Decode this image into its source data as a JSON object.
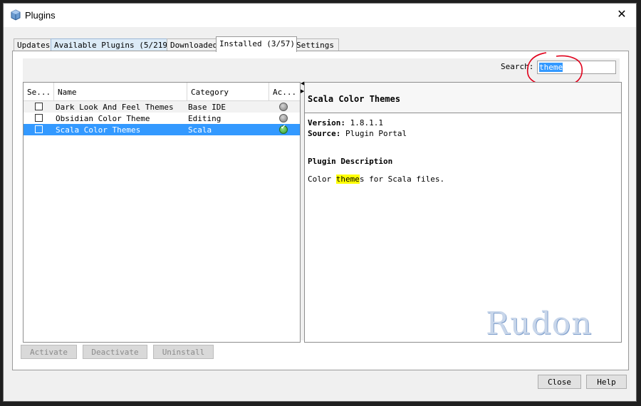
{
  "window": {
    "title": "Plugins"
  },
  "tabs": [
    {
      "label": "Updates"
    },
    {
      "label": "Available Plugins (5/219)"
    },
    {
      "label": "Downloaded"
    },
    {
      "label": "Installed (3/57)"
    },
    {
      "label": "Settings"
    }
  ],
  "search": {
    "label": "Search:",
    "value": "theme"
  },
  "table": {
    "columns": [
      "Se...",
      "Name",
      "Category",
      "Ac..."
    ],
    "rows": [
      {
        "name": "Dark Look And Feel Themes",
        "category": "Base IDE",
        "checked": false,
        "status_icon": "gray-circle-icon"
      },
      {
        "name": "Obsidian Color Theme",
        "category": "Editing",
        "checked": false,
        "status_icon": "gray-circle-icon"
      },
      {
        "name": "Scala Color Themes",
        "category": "Scala",
        "checked": false,
        "status_icon": "green-check-icon",
        "selected": true
      }
    ]
  },
  "details": {
    "title": "Scala Color Themes",
    "version_label": "Version:",
    "version_value": "1.8.1.1",
    "source_label": "Source:",
    "source_value": "Plugin Portal",
    "description_heading": "Plugin Description",
    "description_text_before": "Color ",
    "description_highlight": "theme",
    "description_text_after": "s for Scala files."
  },
  "watermark": "Rudon",
  "buttons": {
    "activate": "Activate",
    "deactivate": "Deactivate",
    "uninstall": "Uninstall",
    "close": "Close",
    "help": "Help"
  },
  "colors": {
    "selection": "#3399ff",
    "highlight": "#ffff00",
    "annotation": "#e0001b"
  }
}
